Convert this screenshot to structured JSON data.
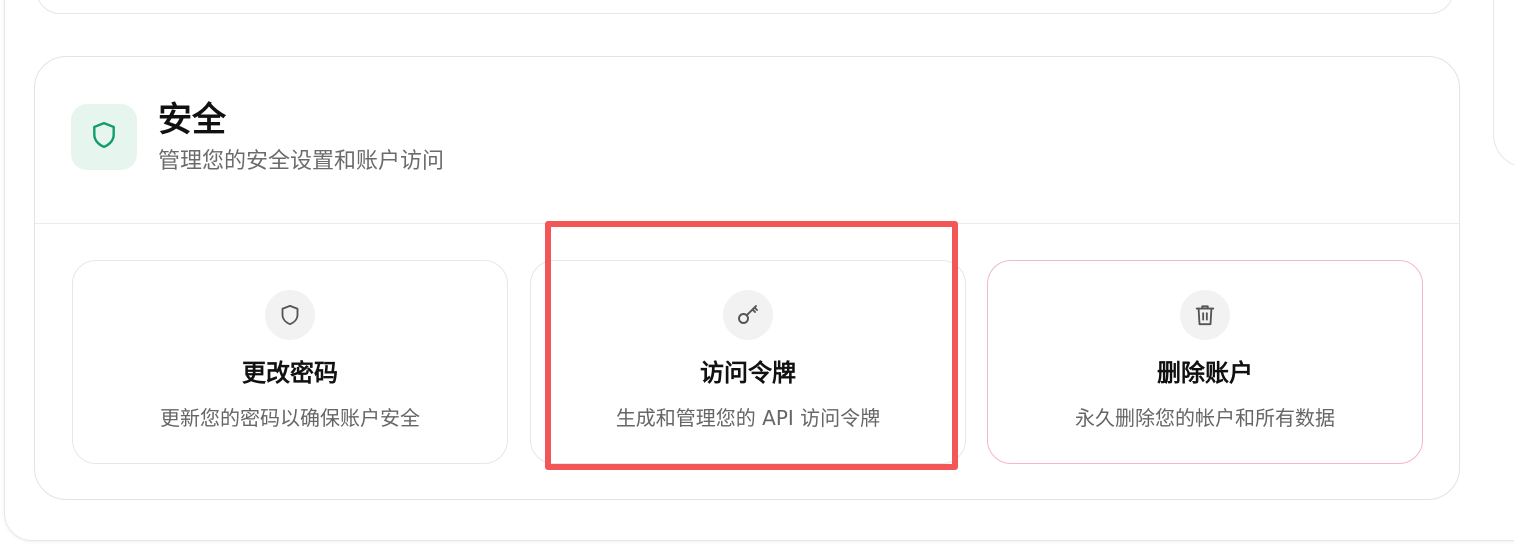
{
  "security": {
    "title": "安全",
    "subtitle": "管理您的安全设置和账户访问",
    "icon": "shield-icon",
    "accent_color": "#0f9d6b",
    "accent_bg": "#e7f5ef"
  },
  "options": [
    {
      "title": "更改密码",
      "description": "更新您的密码以确保账户安全",
      "icon": "shield-icon"
    },
    {
      "title": "访问令牌",
      "description": "生成和管理您的 API 访问令牌",
      "icon": "key-icon"
    },
    {
      "title": "删除账户",
      "description": "永久删除您的帐户和所有数据",
      "icon": "trash-icon",
      "border_color": "#f3b8c3"
    }
  ],
  "highlight": {
    "color": "#f25656",
    "target": "访问令牌"
  }
}
